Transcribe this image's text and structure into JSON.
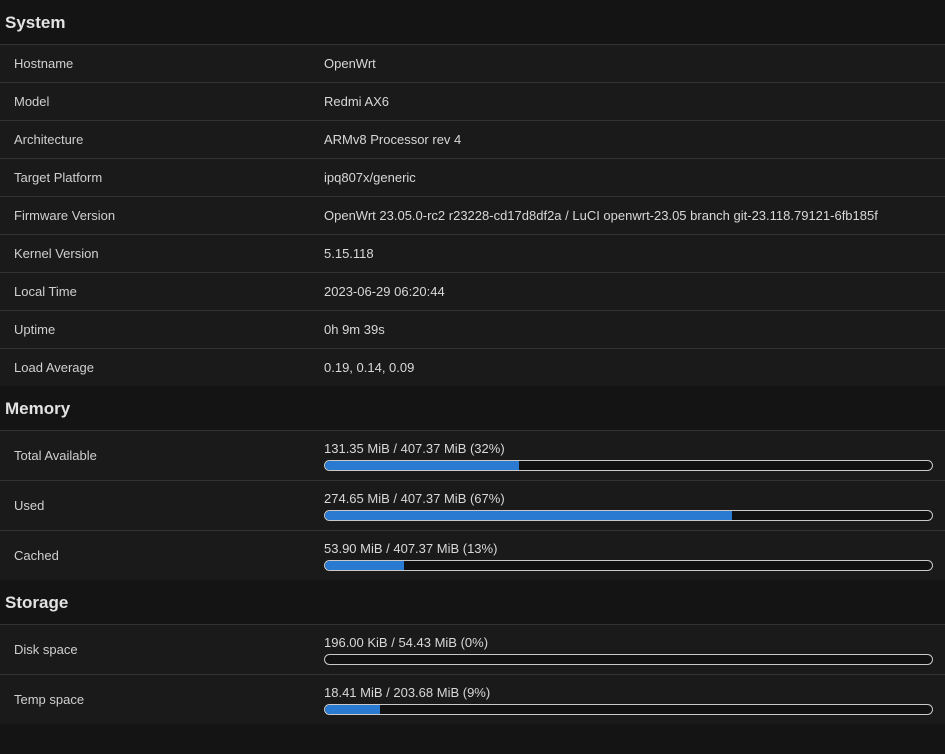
{
  "accent_color": "#2b7ad1",
  "sections": [
    {
      "title": "System",
      "type": "plain",
      "rows": [
        {
          "label": "Hostname",
          "value": "OpenWrt"
        },
        {
          "label": "Model",
          "value": "Redmi AX6"
        },
        {
          "label": "Architecture",
          "value": "ARMv8 Processor rev 4"
        },
        {
          "label": "Target Platform",
          "value": "ipq807x/generic"
        },
        {
          "label": "Firmware Version",
          "value": "OpenWrt 23.05.0-rc2 r23228-cd17d8df2a / LuCI openwrt-23.05 branch git-23.118.79121-6fb185f"
        },
        {
          "label": "Kernel Version",
          "value": "5.15.118"
        },
        {
          "label": "Local Time",
          "value": "2023-06-29 06:20:44"
        },
        {
          "label": "Uptime",
          "value": "0h 9m 39s"
        },
        {
          "label": "Load Average",
          "value": "0.19, 0.14, 0.09"
        }
      ]
    },
    {
      "title": "Memory",
      "type": "meter",
      "rows": [
        {
          "label": "Total Available",
          "value": "131.35 MiB / 407.37 MiB (32%)",
          "percent": 32
        },
        {
          "label": "Used",
          "value": "274.65 MiB / 407.37 MiB (67%)",
          "percent": 67
        },
        {
          "label": "Cached",
          "value": "53.90 MiB / 407.37 MiB (13%)",
          "percent": 13
        }
      ]
    },
    {
      "title": "Storage",
      "type": "meter",
      "rows": [
        {
          "label": "Disk space",
          "value": "196.00 KiB / 54.43 MiB (0%)",
          "percent": 0
        },
        {
          "label": "Temp space",
          "value": "18.41 MiB / 203.68 MiB (9%)",
          "percent": 9
        }
      ]
    }
  ]
}
